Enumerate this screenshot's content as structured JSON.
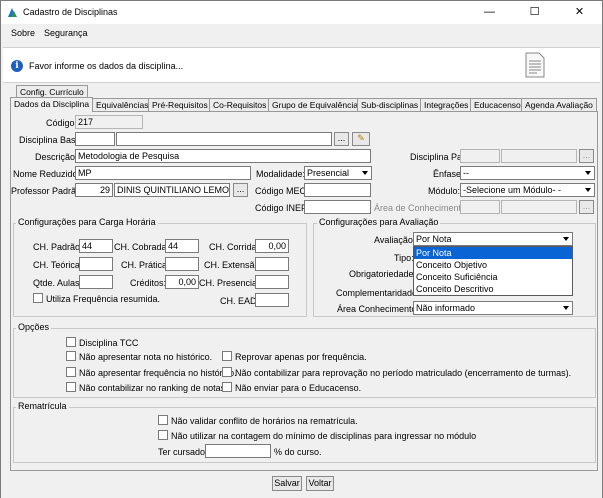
{
  "window": {
    "title": "Cadastro de Disciplinas",
    "minimize": "—",
    "maximize": "☐",
    "close": "✕"
  },
  "menu": {
    "items": [
      "Sobre",
      "Segurança"
    ]
  },
  "info": {
    "message": "Favor informe os dados da disciplina..."
  },
  "tabs": {
    "top_row": [
      "Config. Currículo"
    ],
    "bottom_row": [
      "Dados da Disciplina",
      "Equivalências",
      "Pré-Requisitos",
      "Co-Requisitos",
      "Grupo de Equivalência",
      "Sub-disciplinas",
      "Integrações",
      "Educacenso",
      "Agenda Avaliação"
    ]
  },
  "form": {
    "codigo_label": "Código:",
    "codigo_value": "217",
    "disciplina_base_label": "Disciplina Base:",
    "disciplina_base_value": "",
    "descricao_label": "Descrição:",
    "descricao_value": "Metodologia de Pesquisa",
    "nome_reduzido_label": "Nome Reduzido:",
    "nome_reduzido_value": "MP",
    "professor_label": "Professor Padrão:",
    "professor_code": "29",
    "professor_name": "DINIS QUINTILIANO LEMOS",
    "disciplina_pai_label": "Disciplina Pai:",
    "modalidade_label": "Modalidade:",
    "modalidade_value": "Presencial",
    "enfase_label": "Ênfase:",
    "enfase_value": "--",
    "codigo_mec_label": "Código MEC:",
    "codigo_mec_value": "",
    "modulo_label": "Módulo:",
    "modulo_value": "-Selecione um Módulo- -",
    "codigo_inep_label": "Código INEP:",
    "codigo_inep_value": "",
    "area_conhecimento_label": "Área de Conhecimento:",
    "ellipsis": "...",
    "pencil": "✎"
  },
  "carga": {
    "title": "Configurações para Carga Horária",
    "ch_padrao_label": "CH. Padrão:",
    "ch_padrao_value": "44",
    "ch_cobrada_label": "CH. Cobrada:",
    "ch_cobrada_value": "44",
    "ch_corrida_label": "CH. Corrida:",
    "ch_corrida_value": "0,00",
    "ch_teorica_label": "CH. Teórica:",
    "ch_teorica_value": "",
    "ch_pratica_label": "CH. Prática:",
    "ch_pratica_value": "",
    "ch_extensao_label": "CH. Extensão:",
    "ch_extensao_value": "",
    "qtde_aulas_label": "Qtde. Aulas:",
    "qtde_aulas_value": "",
    "creditos_label": "Créditos:",
    "creditos_value": "0,00",
    "ch_presencial_label": "CH. Presencial:",
    "ch_presencial_value": "",
    "frequencia_label": "Utiliza Frequência resumida.",
    "ch_ead_label": "CH. EAD:",
    "ch_ead_value": ""
  },
  "avaliacao": {
    "title": "Configurações para Avaliação",
    "avaliacao_label": "Avaliação:",
    "avaliacao_value": "Por Nota",
    "tipo_label": "Tipo:",
    "obrigatoriedade_label": "Obrigatoriedade:",
    "complementaridade_label": "Complementaridade:",
    "area_label": "Área Conhecimento:",
    "area_value": "Não informado",
    "options": [
      "Por Nota",
      "Conceito Objetivo",
      "Conceito Suficiência",
      "Conceito Descritivo"
    ]
  },
  "opcoes": {
    "title": "Opções",
    "items": [
      "Disciplina TCC",
      "Não apresentar nota no histórico.",
      "Não apresentar frequência no histórico.",
      "Não contabilizar no ranking de notas.",
      "Reprovar apenas por frequência.",
      "Não contabilizar para reprovação no período matriculado (encerramento de turmas).",
      "Não enviar para o Educacenso."
    ]
  },
  "rematricula": {
    "title": "Rematrícula",
    "items": [
      "Não validar conflito de horários na rematrícula.",
      "Não utilizar na contagem do mínimo de disciplinas para ingressar no módulo"
    ],
    "ter_cursado_label": "Ter cursado:",
    "ter_cursado_value": "",
    "ter_cursado_suffix": "% do curso."
  },
  "buttons": {
    "save": "Salvar",
    "back": "Voltar"
  }
}
